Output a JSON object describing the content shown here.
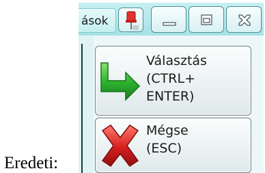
{
  "caption": "Eredeti:",
  "titlebar": {
    "tab_fragment": "ások"
  },
  "window_controls": {
    "pin": "pin-icon",
    "minimize": "minimize-icon",
    "maximize": "maximize-icon",
    "close": "close-icon"
  },
  "actions": {
    "select": {
      "lines": [
        "Választás",
        "(CTRL+",
        "ENTER)"
      ],
      "icon": "green-arrow-icon"
    },
    "cancel": {
      "lines": [
        "Mégse",
        "(ESC)"
      ],
      "icon": "red-x-icon"
    }
  },
  "colors": {
    "titlebar": "#b6e8ec",
    "accent_green": "#2fb52f",
    "accent_red": "#d61f1f"
  }
}
